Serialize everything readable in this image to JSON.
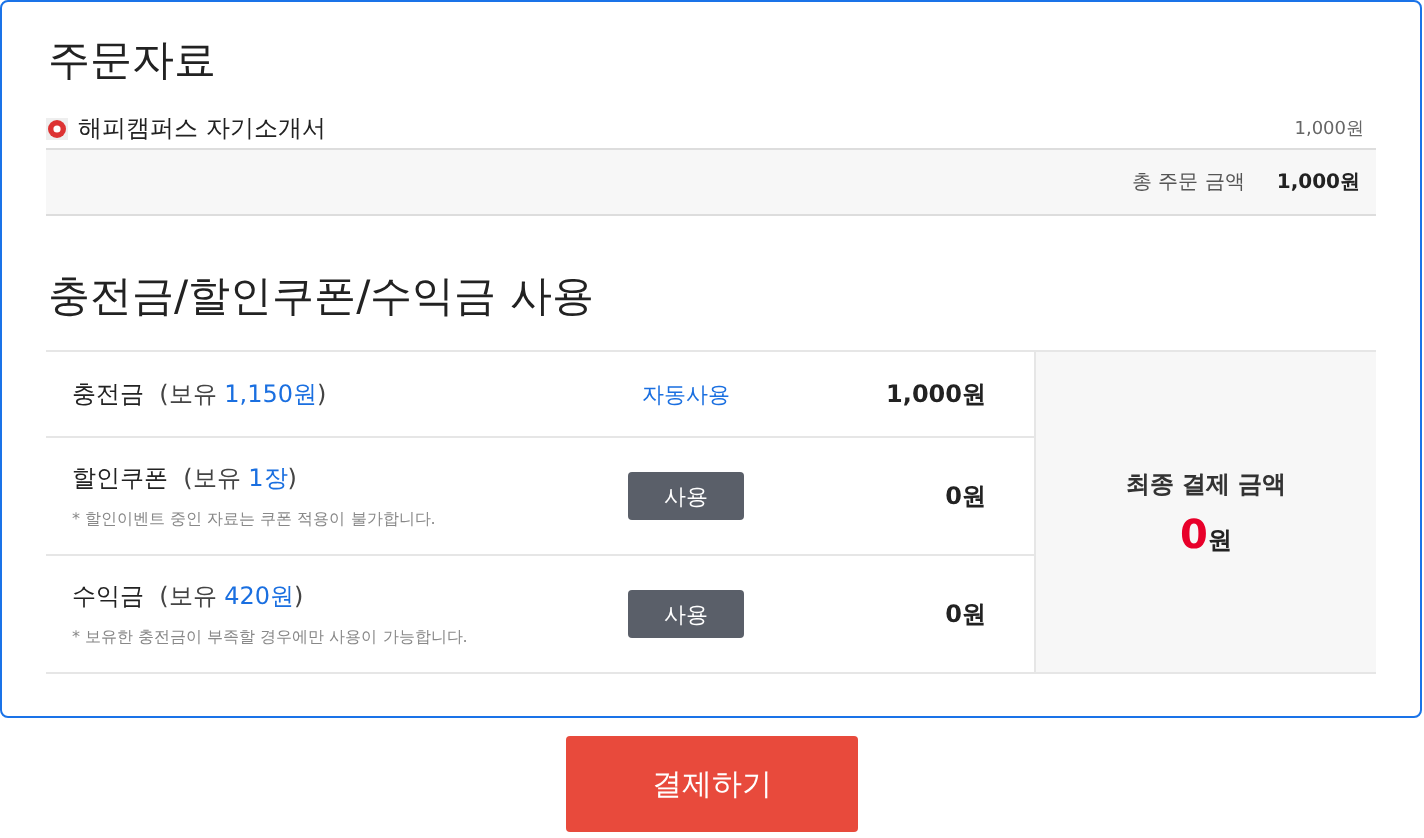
{
  "order": {
    "title": "주문자료",
    "items": [
      {
        "name": "해피캠퍼스 자기소개서",
        "price": "1,000원"
      }
    ],
    "total_label": "총 주문 금액",
    "total": "1,000원"
  },
  "discount": {
    "title": "충전금/할인쿠폰/수익금 사용",
    "rows": [
      {
        "kind": "auto",
        "label": "충전금",
        "held_open": "(보유",
        "held_amount": "1,150원",
        "held_close": ")",
        "action": "자동사용",
        "amount": "1,000원"
      },
      {
        "kind": "button",
        "label": "할인쿠폰",
        "held_open": "(보유",
        "held_amount": "1장",
        "held_close": ")",
        "note": "* 할인이벤트 중인 자료는 쿠폰 적용이 불가합니다.",
        "action": "사용",
        "amount": "0원"
      },
      {
        "kind": "button",
        "label": "수익금",
        "held_open": "(보유",
        "held_amount": "420원",
        "held_close": ")",
        "note": "* 보유한 충전금이 부족할 경우에만 사용이 가능합니다.",
        "action": "사용",
        "amount": "0원"
      }
    ],
    "final_label": "최종 결제 금액",
    "final_value": "0",
    "final_unit": "원"
  },
  "pay_button": "결제하기"
}
